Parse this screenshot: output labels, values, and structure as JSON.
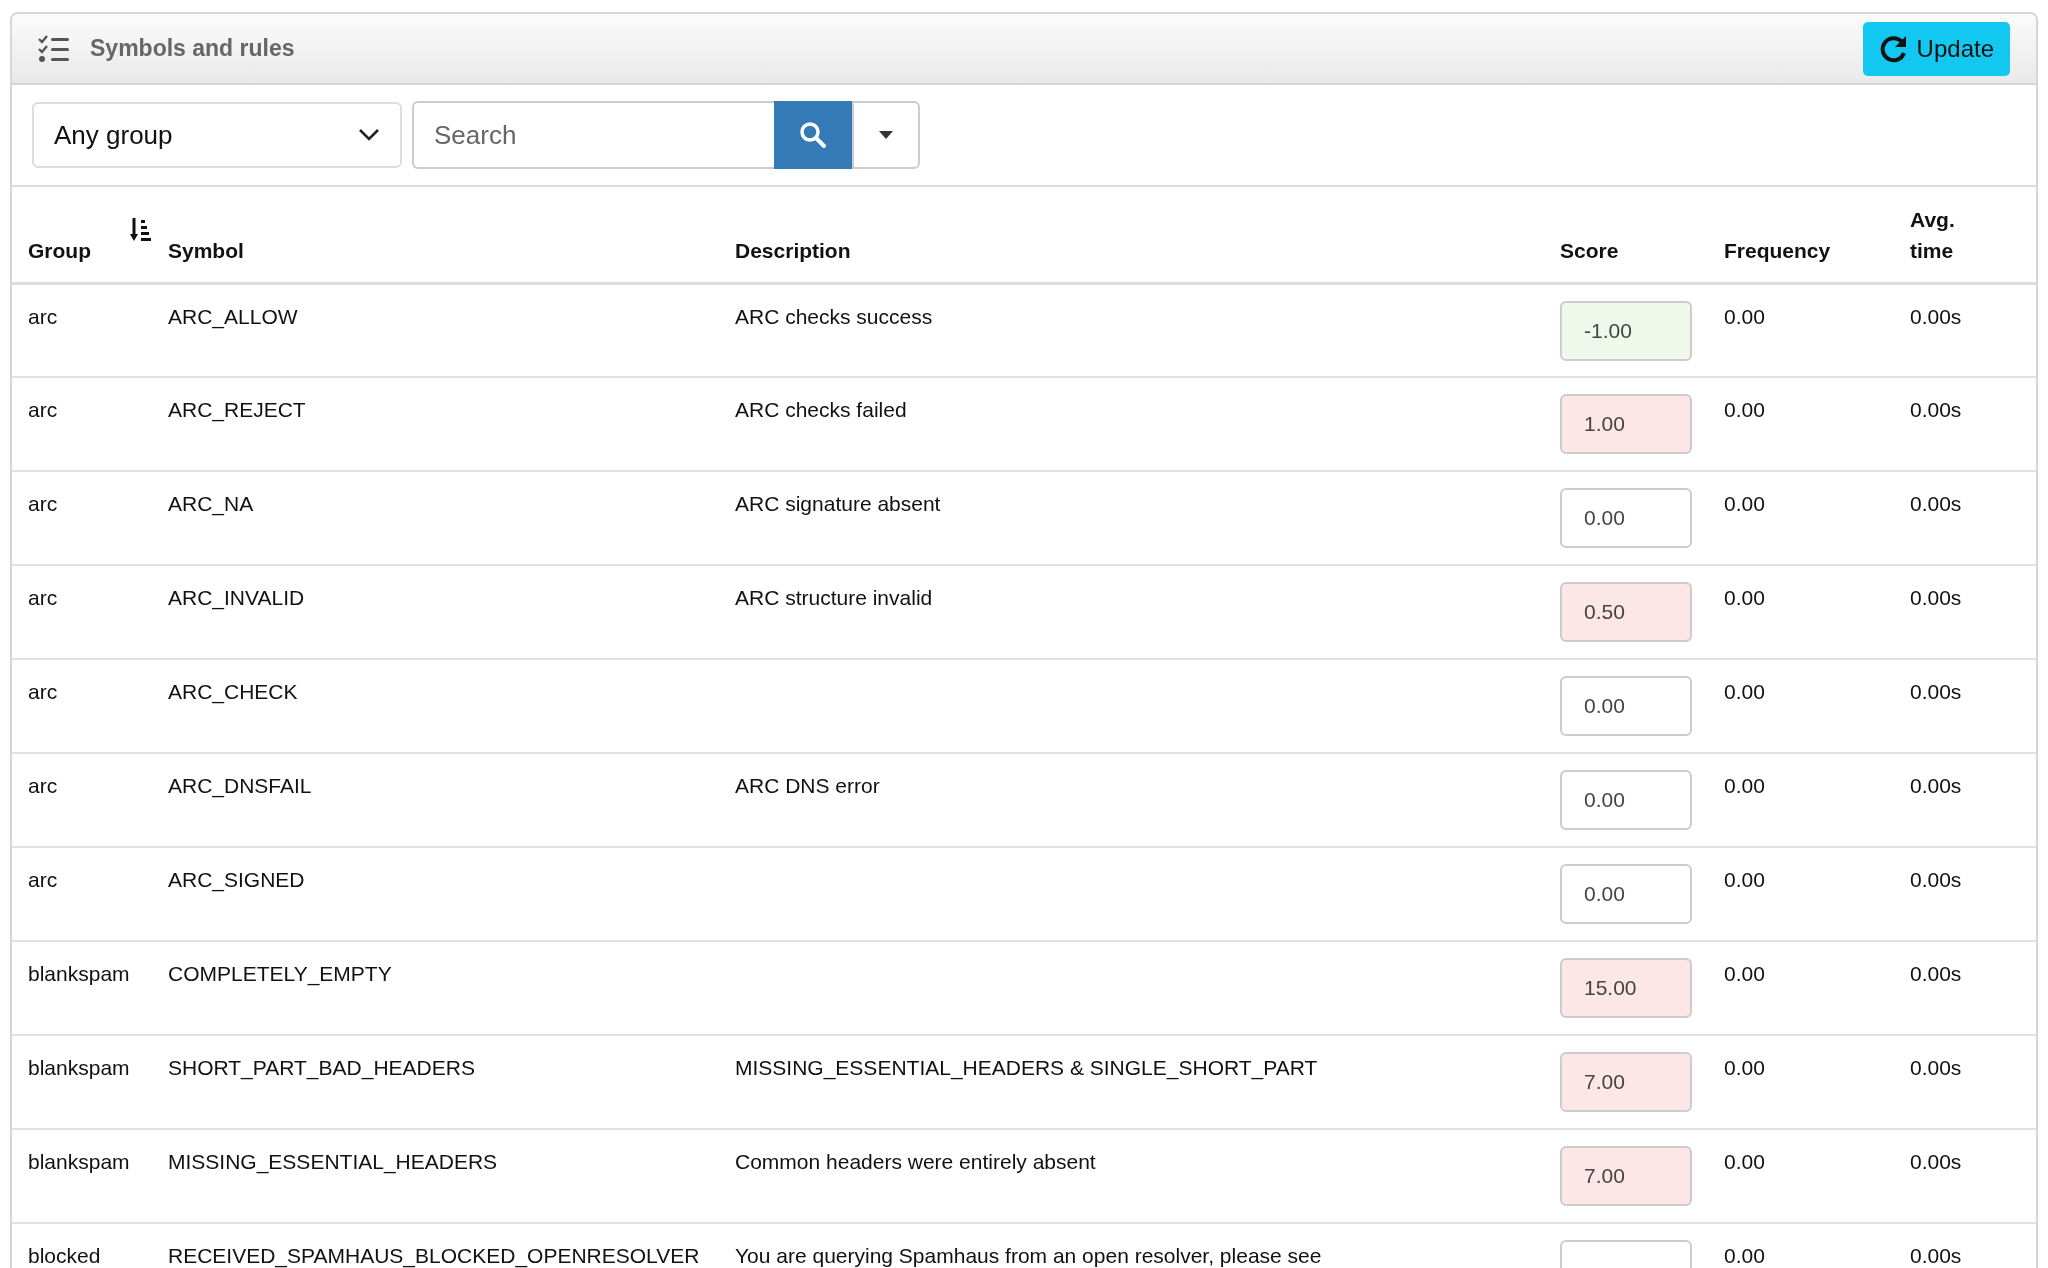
{
  "card": {
    "title": "Symbols and rules",
    "update_button": "Update"
  },
  "toolbar": {
    "group_select": "Any group",
    "search": {
      "placeholder": "Search"
    }
  },
  "table": {
    "columns": [
      {
        "label": "Group",
        "sorted": true
      },
      {
        "label": "Symbol",
        "sorted": false
      },
      {
        "label": "Description",
        "sorted": false
      },
      {
        "label": "Score",
        "sorted": false
      },
      {
        "label": "Frequency",
        "sorted": false
      },
      {
        "label": "Avg. time",
        "sorted": false
      }
    ],
    "rows": [
      {
        "group": "arc",
        "symbol": "ARC_ALLOW",
        "description": "ARC checks success",
        "score": "-1.00",
        "color": "#eef9ec",
        "frequency": "0.00",
        "avg_time": "0.00s"
      },
      {
        "group": "arc",
        "symbol": "ARC_REJECT",
        "description": "ARC checks failed",
        "score": "1.00",
        "color": "#fde6e6",
        "frequency": "0.00",
        "avg_time": "0.00s"
      },
      {
        "group": "arc",
        "symbol": "ARC_NA",
        "description": "ARC signature absent",
        "score": "0.00",
        "color": "#ffffff",
        "frequency": "0.00",
        "avg_time": "0.00s"
      },
      {
        "group": "arc",
        "symbol": "ARC_INVALID",
        "description": "ARC structure invalid",
        "score": "0.50",
        "color": "#fde6e6",
        "frequency": "0.00",
        "avg_time": "0.00s"
      },
      {
        "group": "arc",
        "symbol": "ARC_CHECK",
        "score": "0.00",
        "color": "#ffffff",
        "frequency": "0.00",
        "avg_time": "0.00s"
      },
      {
        "group": "arc",
        "symbol": "ARC_DNSFAIL",
        "description": "ARC DNS error",
        "score": "0.00",
        "color": "#ffffff",
        "frequency": "0.00",
        "avg_time": "0.00s"
      },
      {
        "group": "arc",
        "symbol": "ARC_SIGNED",
        "score": "0.00",
        "color": "#ffffff",
        "frequency": "0.00",
        "avg_time": "0.00s"
      },
      {
        "group": "blankspam",
        "symbol": "COMPLETELY_EMPTY",
        "score": "15.00",
        "color": "#fde6e6",
        "frequency": "0.00",
        "avg_time": "0.00s"
      },
      {
        "group": "blankspam",
        "symbol": "SHORT_PART_BAD_HEADERS",
        "description": "MISSING_ESSENTIAL_HEADERS & SINGLE_SHORT_PART",
        "score": "7.00",
        "color": "#fde6e6",
        "frequency": "0.00",
        "avg_time": "0.00s"
      },
      {
        "group": "blankspam",
        "symbol": "MISSING_ESSENTIAL_HEADERS",
        "description": "Common headers were entirely absent",
        "score": "7.00",
        "color": "#fde6e6",
        "frequency": "0.00",
        "avg_time": "0.00s"
      },
      {
        "group": "blocked",
        "symbol": "RECEIVED_SPAMHAUS_BLOCKED_OPENRESOLVER",
        "description": "You are querying Spamhaus from an open resolver, please see",
        "color": "#ffffff",
        "frequency": "0.00",
        "avg_time": "0.00s"
      }
    ]
  }
}
